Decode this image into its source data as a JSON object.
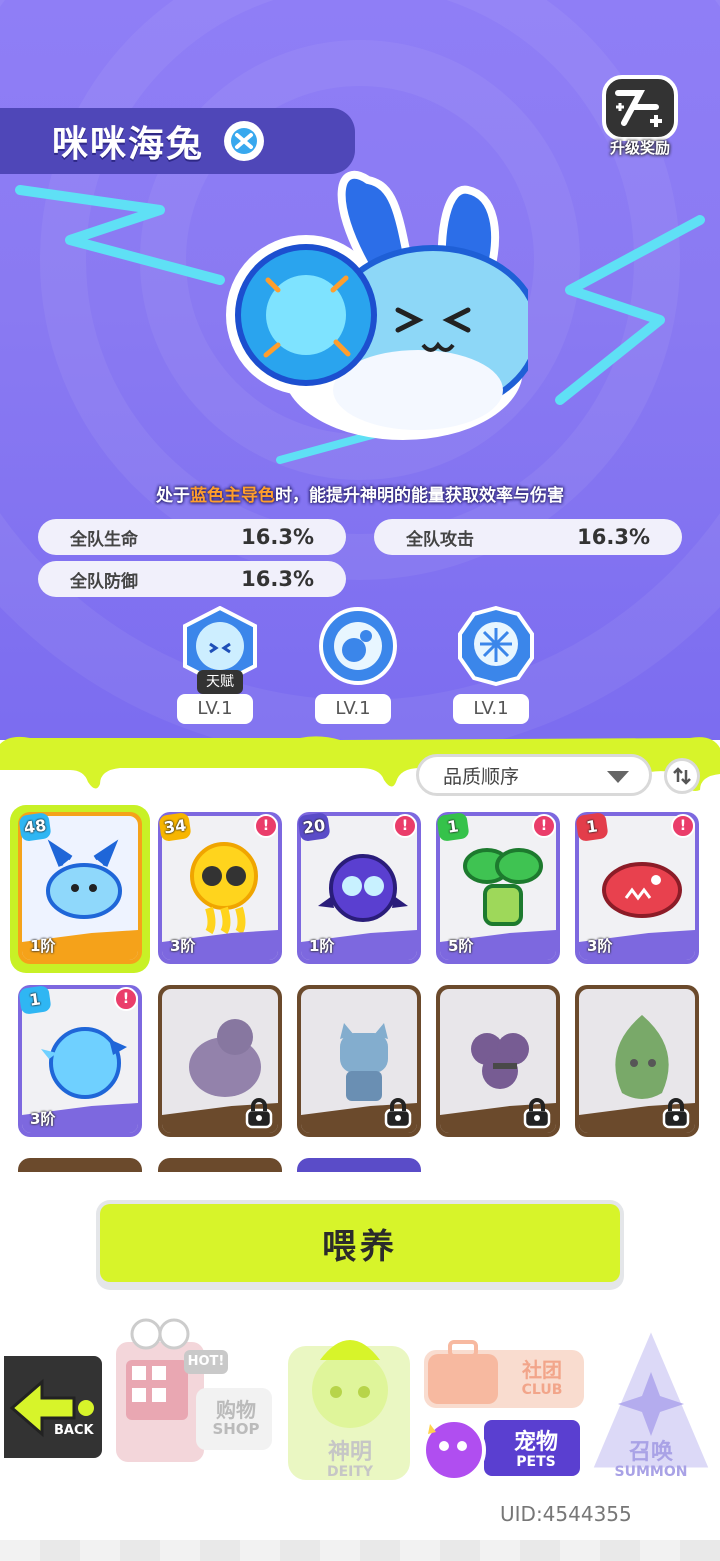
{
  "pet": {
    "name": "咪咪海兔",
    "description_prefix": "处于",
    "description_highlight": "蓝色主导色",
    "description_suffix": "时，能提升神明的能量获取效率与伤害"
  },
  "upgrade_reward": {
    "label": "升级奖励"
  },
  "stats": [
    {
      "label": "全队生命",
      "value": "16.3%"
    },
    {
      "label": "全队攻击",
      "value": "16.3%"
    },
    {
      "label": "全队防御",
      "value": "16.3%"
    }
  ],
  "skills": [
    {
      "tag": "天赋",
      "level": "LV.1",
      "icon": "bunny-skill-icon"
    },
    {
      "level": "LV.1",
      "icon": "bubble-skill-icon"
    },
    {
      "level": "LV.1",
      "icon": "pompom-skill-icon"
    }
  ],
  "sort": {
    "selected": "品质顺序"
  },
  "pets": [
    {
      "level": "48",
      "tier": "1阶",
      "state": "owned",
      "selected": true,
      "color": "#2fb6f3",
      "art": "blue-axolotl"
    },
    {
      "level": "34",
      "tier": "3阶",
      "state": "owned",
      "alert": "!",
      "color": "#f7b500",
      "art": "yellow-jellyfish"
    },
    {
      "level": "20",
      "tier": "1阶",
      "state": "owned",
      "alert": "!",
      "color": "#5a4cc8",
      "art": "purple-bat-cat"
    },
    {
      "level": "1",
      "tier": "5阶",
      "state": "owned",
      "alert": "!",
      "color": "#35c24a",
      "art": "green-sprout"
    },
    {
      "level": "1",
      "tier": "3阶",
      "state": "owned",
      "alert": "!",
      "color": "#e33d4a",
      "art": "red-piranha"
    },
    {
      "level": "1",
      "tier": "3阶",
      "state": "owned",
      "alert": "!",
      "color": "#2fb6f3",
      "art": "blue-bird"
    },
    {
      "state": "locked",
      "art": "purple-pigeon"
    },
    {
      "state": "locked",
      "art": "blue-cat"
    },
    {
      "state": "locked",
      "art": "grape-bunch"
    },
    {
      "state": "locked",
      "art": "green-leaf"
    }
  ],
  "feed_button": {
    "label": "喂养"
  },
  "nav": {
    "back": "BACK",
    "shop_cn": "购物",
    "shop_en": "SHOP",
    "shop_hot": "HOT!",
    "deity_cn": "神明",
    "deity_en": "DEITY",
    "club_cn": "社团",
    "club_en": "CLUB",
    "pets_cn": "宠物",
    "pets_en": "PETS",
    "summon_cn": "召唤",
    "summon_en": "SUMMON"
  },
  "uid": "UID:4544355",
  "colors": {
    "hero_bg": "#8a7af2",
    "accent_lime": "#d7f42a",
    "highlight_orange": "#ff9e2c",
    "owned_card": "#7d68df",
    "locked_card": "#6b4a2c"
  }
}
